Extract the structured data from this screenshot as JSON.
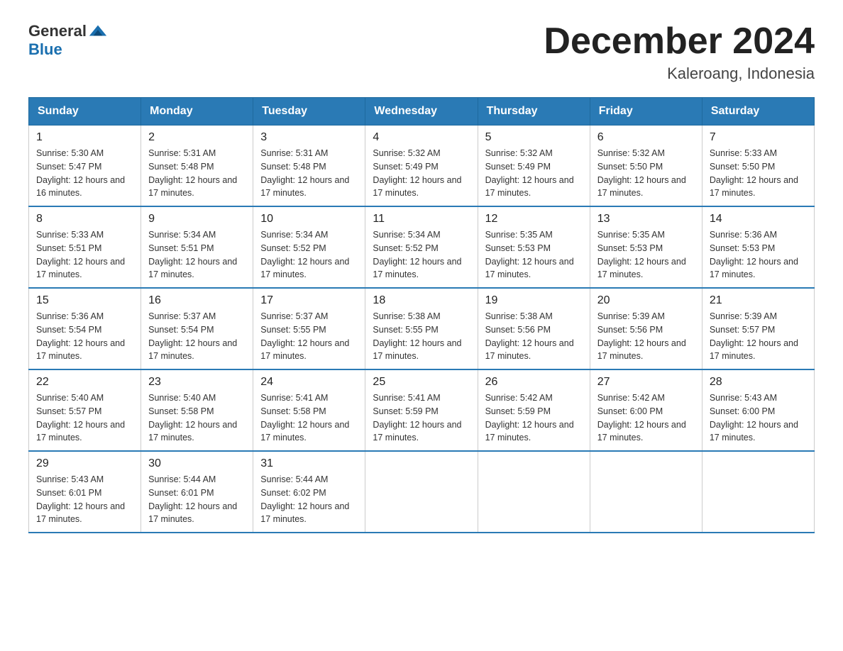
{
  "header": {
    "logo_general": "General",
    "logo_blue": "Blue",
    "title": "December 2024",
    "location": "Kaleroang, Indonesia"
  },
  "weekdays": [
    "Sunday",
    "Monday",
    "Tuesday",
    "Wednesday",
    "Thursday",
    "Friday",
    "Saturday"
  ],
  "weeks": [
    [
      {
        "day": "1",
        "sunrise": "5:30 AM",
        "sunset": "5:47 PM",
        "daylight": "12 hours and 16 minutes."
      },
      {
        "day": "2",
        "sunrise": "5:31 AM",
        "sunset": "5:48 PM",
        "daylight": "12 hours and 17 minutes."
      },
      {
        "day": "3",
        "sunrise": "5:31 AM",
        "sunset": "5:48 PM",
        "daylight": "12 hours and 17 minutes."
      },
      {
        "day": "4",
        "sunrise": "5:32 AM",
        "sunset": "5:49 PM",
        "daylight": "12 hours and 17 minutes."
      },
      {
        "day": "5",
        "sunrise": "5:32 AM",
        "sunset": "5:49 PM",
        "daylight": "12 hours and 17 minutes."
      },
      {
        "day": "6",
        "sunrise": "5:32 AM",
        "sunset": "5:50 PM",
        "daylight": "12 hours and 17 minutes."
      },
      {
        "day": "7",
        "sunrise": "5:33 AM",
        "sunset": "5:50 PM",
        "daylight": "12 hours and 17 minutes."
      }
    ],
    [
      {
        "day": "8",
        "sunrise": "5:33 AM",
        "sunset": "5:51 PM",
        "daylight": "12 hours and 17 minutes."
      },
      {
        "day": "9",
        "sunrise": "5:34 AM",
        "sunset": "5:51 PM",
        "daylight": "12 hours and 17 minutes."
      },
      {
        "day": "10",
        "sunrise": "5:34 AM",
        "sunset": "5:52 PM",
        "daylight": "12 hours and 17 minutes."
      },
      {
        "day": "11",
        "sunrise": "5:34 AM",
        "sunset": "5:52 PM",
        "daylight": "12 hours and 17 minutes."
      },
      {
        "day": "12",
        "sunrise": "5:35 AM",
        "sunset": "5:53 PM",
        "daylight": "12 hours and 17 minutes."
      },
      {
        "day": "13",
        "sunrise": "5:35 AM",
        "sunset": "5:53 PM",
        "daylight": "12 hours and 17 minutes."
      },
      {
        "day": "14",
        "sunrise": "5:36 AM",
        "sunset": "5:53 PM",
        "daylight": "12 hours and 17 minutes."
      }
    ],
    [
      {
        "day": "15",
        "sunrise": "5:36 AM",
        "sunset": "5:54 PM",
        "daylight": "12 hours and 17 minutes."
      },
      {
        "day": "16",
        "sunrise": "5:37 AM",
        "sunset": "5:54 PM",
        "daylight": "12 hours and 17 minutes."
      },
      {
        "day": "17",
        "sunrise": "5:37 AM",
        "sunset": "5:55 PM",
        "daylight": "12 hours and 17 minutes."
      },
      {
        "day": "18",
        "sunrise": "5:38 AM",
        "sunset": "5:55 PM",
        "daylight": "12 hours and 17 minutes."
      },
      {
        "day": "19",
        "sunrise": "5:38 AM",
        "sunset": "5:56 PM",
        "daylight": "12 hours and 17 minutes."
      },
      {
        "day": "20",
        "sunrise": "5:39 AM",
        "sunset": "5:56 PM",
        "daylight": "12 hours and 17 minutes."
      },
      {
        "day": "21",
        "sunrise": "5:39 AM",
        "sunset": "5:57 PM",
        "daylight": "12 hours and 17 minutes."
      }
    ],
    [
      {
        "day": "22",
        "sunrise": "5:40 AM",
        "sunset": "5:57 PM",
        "daylight": "12 hours and 17 minutes."
      },
      {
        "day": "23",
        "sunrise": "5:40 AM",
        "sunset": "5:58 PM",
        "daylight": "12 hours and 17 minutes."
      },
      {
        "day": "24",
        "sunrise": "5:41 AM",
        "sunset": "5:58 PM",
        "daylight": "12 hours and 17 minutes."
      },
      {
        "day": "25",
        "sunrise": "5:41 AM",
        "sunset": "5:59 PM",
        "daylight": "12 hours and 17 minutes."
      },
      {
        "day": "26",
        "sunrise": "5:42 AM",
        "sunset": "5:59 PM",
        "daylight": "12 hours and 17 minutes."
      },
      {
        "day": "27",
        "sunrise": "5:42 AM",
        "sunset": "6:00 PM",
        "daylight": "12 hours and 17 minutes."
      },
      {
        "day": "28",
        "sunrise": "5:43 AM",
        "sunset": "6:00 PM",
        "daylight": "12 hours and 17 minutes."
      }
    ],
    [
      {
        "day": "29",
        "sunrise": "5:43 AM",
        "sunset": "6:01 PM",
        "daylight": "12 hours and 17 minutes."
      },
      {
        "day": "30",
        "sunrise": "5:44 AM",
        "sunset": "6:01 PM",
        "daylight": "12 hours and 17 minutes."
      },
      {
        "day": "31",
        "sunrise": "5:44 AM",
        "sunset": "6:02 PM",
        "daylight": "12 hours and 17 minutes."
      },
      null,
      null,
      null,
      null
    ]
  ]
}
